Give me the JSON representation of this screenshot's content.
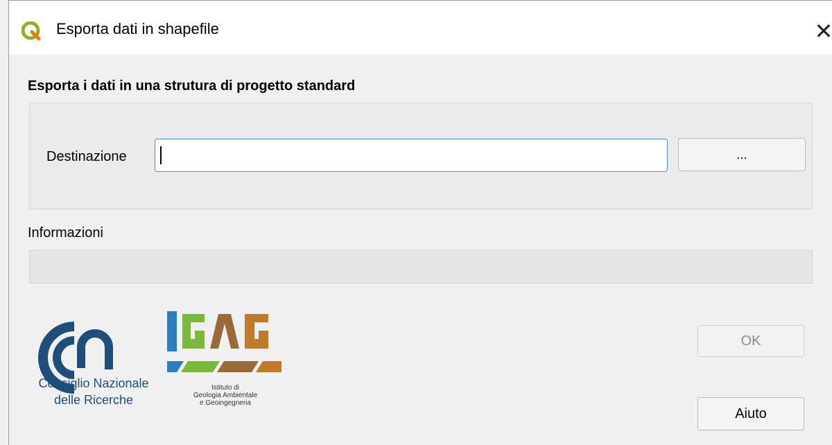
{
  "window": {
    "title": "Esporta dati in shapefile",
    "close_glyph": "✕",
    "app_icon": "qgis-icon"
  },
  "section": {
    "title": "Esporta i dati in una strutura di progetto standard"
  },
  "destination": {
    "label": "Destinazione",
    "value": "",
    "placeholder": "",
    "browse_label": "..."
  },
  "info": {
    "label": "Informazioni",
    "value": ""
  },
  "logos": {
    "cnr": {
      "line1": "Consiglio Nazionale",
      "line2": "delle Ricerche"
    },
    "igag": {
      "wordmark": "IGAG",
      "sub1": "Istituto di",
      "sub2": "Geologia Ambientale",
      "sub3": "e Geoingegneria"
    }
  },
  "buttons": {
    "ok_label": "OK",
    "help_label": "Aiuto"
  },
  "colors": {
    "accent_focus": "#4a90e2",
    "qgis_green": "#93b023",
    "cnr_blue": "#1f4e7a"
  }
}
